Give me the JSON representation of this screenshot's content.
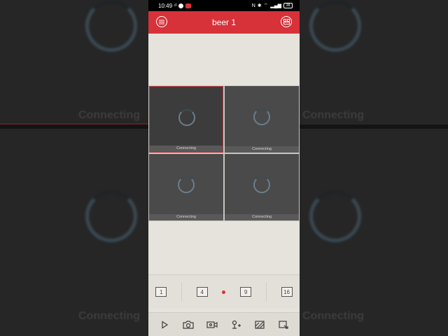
{
  "status_bar": {
    "time": "10:49",
    "signal_text": "ıl",
    "battery": "38"
  },
  "header": {
    "title": "beer 1"
  },
  "tiles": [
    {
      "label": "Connecting",
      "selected": true
    },
    {
      "label": "Connecting",
      "selected": false
    },
    {
      "label": "Connecting",
      "selected": false
    },
    {
      "label": "Connecting",
      "selected": false
    }
  ],
  "background_text": {
    "connecting": "Connecting"
  },
  "split_options": [
    {
      "label": "1"
    },
    {
      "label": "4"
    },
    {
      "label": "9"
    },
    {
      "label": "16"
    }
  ],
  "toolbar_icons": [
    "play-icon",
    "camera-icon",
    "record-icon",
    "ptz-icon",
    "image-quality-icon",
    "fullscreen-icon"
  ],
  "colors": {
    "accent": "#d7323a",
    "background": "#e6e3dc"
  }
}
